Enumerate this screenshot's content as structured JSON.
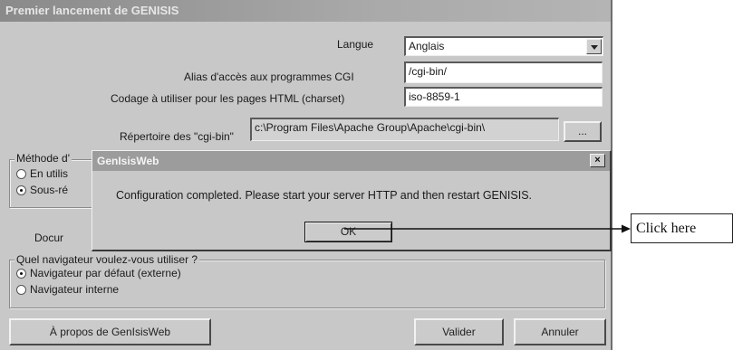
{
  "window": {
    "title": "Premier lancement de GENISIS"
  },
  "form": {
    "language_label": "Langue",
    "language_value": "Anglais",
    "cgi_alias_label": "Alias d'accès aux programmes CGI",
    "cgi_alias_value": "/cgi-bin/",
    "charset_label": "Codage à utiliser pour les pages HTML (charset)",
    "charset_value": "iso-8859-1",
    "cgi_dir_label": "Répertoire des \"cgi-bin\"",
    "cgi_dir_value": "c:\\Program Files\\Apache Group\\Apache\\cgi-bin\\",
    "browse_label": "..."
  },
  "method_group": {
    "title": "Méthode d'",
    "option1": "En utilis",
    "option2": "Sous-ré"
  },
  "doc_label": "Docur",
  "browser_group": {
    "title": "Quel navigateur voulez-vous utiliser ?",
    "option_external": "Navigateur par défaut (externe)",
    "option_internal": "Navigateur interne"
  },
  "buttons": {
    "about": "À propos de GenIsisWeb",
    "validate": "Valider",
    "cancel": "Annuler"
  },
  "dialog": {
    "title": "GenIsisWeb",
    "close": "×",
    "message": "Configuration completed. Please start your server HTTP and then restart GENISIS.",
    "ok": "OK"
  },
  "annotation": {
    "text": "Click here"
  }
}
